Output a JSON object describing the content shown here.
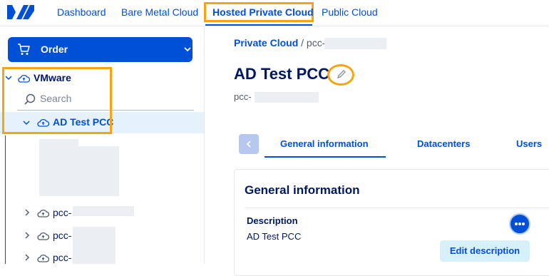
{
  "topnav": {
    "items": [
      "Dashboard",
      "Bare Metal Cloud",
      "Hosted Private Cloud",
      "Public Cloud"
    ],
    "active_index": 2,
    "logo_icon": "ovh-logo-icon"
  },
  "sidebar": {
    "order_label": "Order",
    "tree": {
      "root_label": "VMware",
      "search_placeholder": "Search",
      "selected_label": "AD Test PCC",
      "collapsed_items": [
        "pcc-",
        "pcc-",
        "pcc-"
      ]
    }
  },
  "main": {
    "breadcrumb": {
      "link": "Private Cloud",
      "separator": "/",
      "current": "pcc-"
    },
    "title": "AD Test PCC",
    "subtitle": "pcc-",
    "tabs": [
      "General information",
      "Datacenters",
      "Users"
    ],
    "active_tab_index": 0,
    "card": {
      "title": "General information",
      "description_label": "Description",
      "description_value": "AD Test PCC",
      "edit_description_label": "Edit description"
    }
  },
  "colors": {
    "accent": "#0050d7",
    "highlight": "#f6a314",
    "selected_bg": "#e5f2fb",
    "title_navy": "#00185e"
  }
}
